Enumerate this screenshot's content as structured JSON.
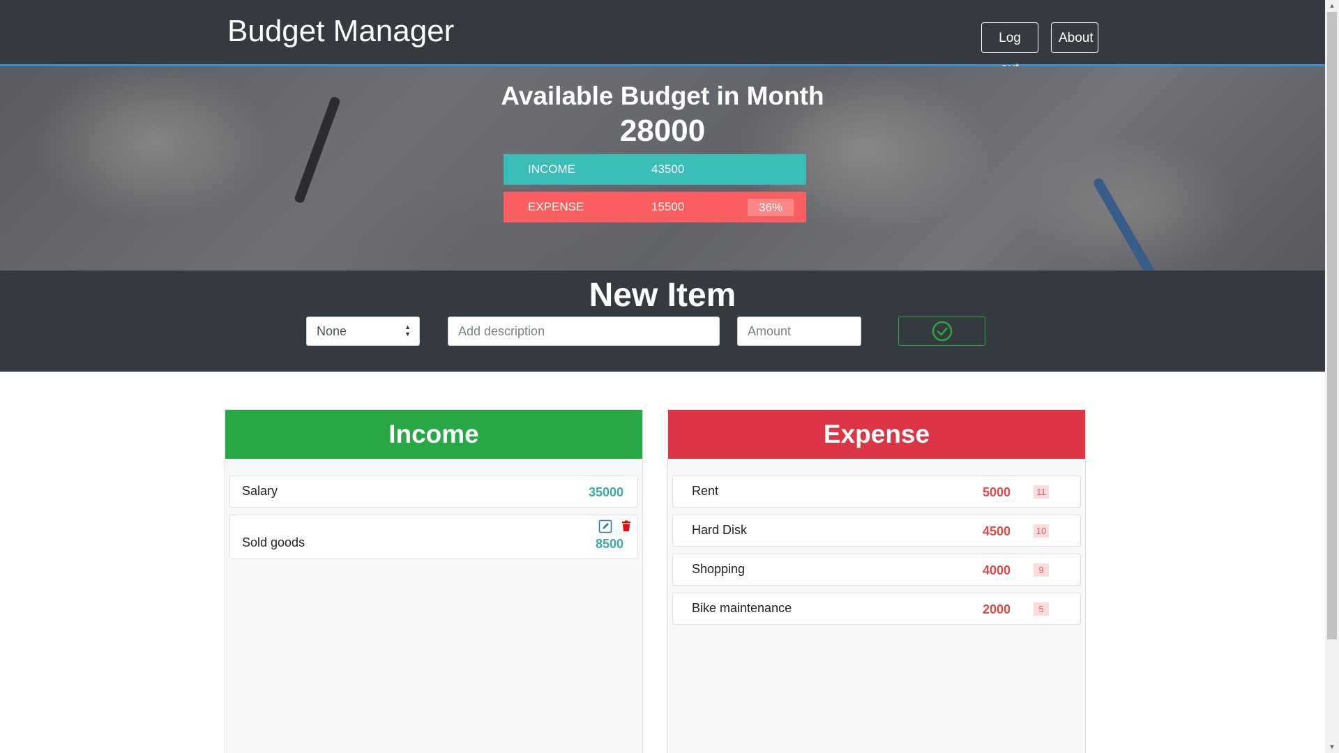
{
  "navbar": {
    "brand": "Budget Manager",
    "logout_label": "Log out",
    "about_label": "About"
  },
  "summary": {
    "title": "Available Budget in Month",
    "available": "28000",
    "income_label": "INCOME",
    "income_value": "43500",
    "expense_label": "EXPENSE",
    "expense_value": "15500",
    "expense_percent": "36%"
  },
  "new_item": {
    "title": "New Item",
    "type_selected": "None",
    "description_placeholder": "Add description",
    "amount_placeholder": "Amount",
    "submit_icon": "check-circle-icon"
  },
  "income": {
    "title": "Income",
    "items": [
      {
        "description": "Salary",
        "value": "35000"
      },
      {
        "description": "Sold goods",
        "value": "8500"
      }
    ],
    "edit_icon": "edit-icon",
    "delete_icon": "trash-icon"
  },
  "expense": {
    "title": "Expense",
    "items": [
      {
        "description": "Rent",
        "value": "5000",
        "percent": "11"
      },
      {
        "description": "Hard Disk",
        "value": "4500",
        "percent": "10"
      },
      {
        "description": "Shopping",
        "value": "4000",
        "percent": "9"
      },
      {
        "description": "Bike maintenance",
        "value": "2000",
        "percent": "5"
      }
    ]
  },
  "colors": {
    "navbar": "#343a40",
    "income_bar": "#3bbdb7",
    "expense_bar": "#fb5f5f",
    "income_header": "#28a745",
    "expense_header": "#dc3545",
    "income_value": "#3aa8a6",
    "expense_value": "#e04848"
  }
}
